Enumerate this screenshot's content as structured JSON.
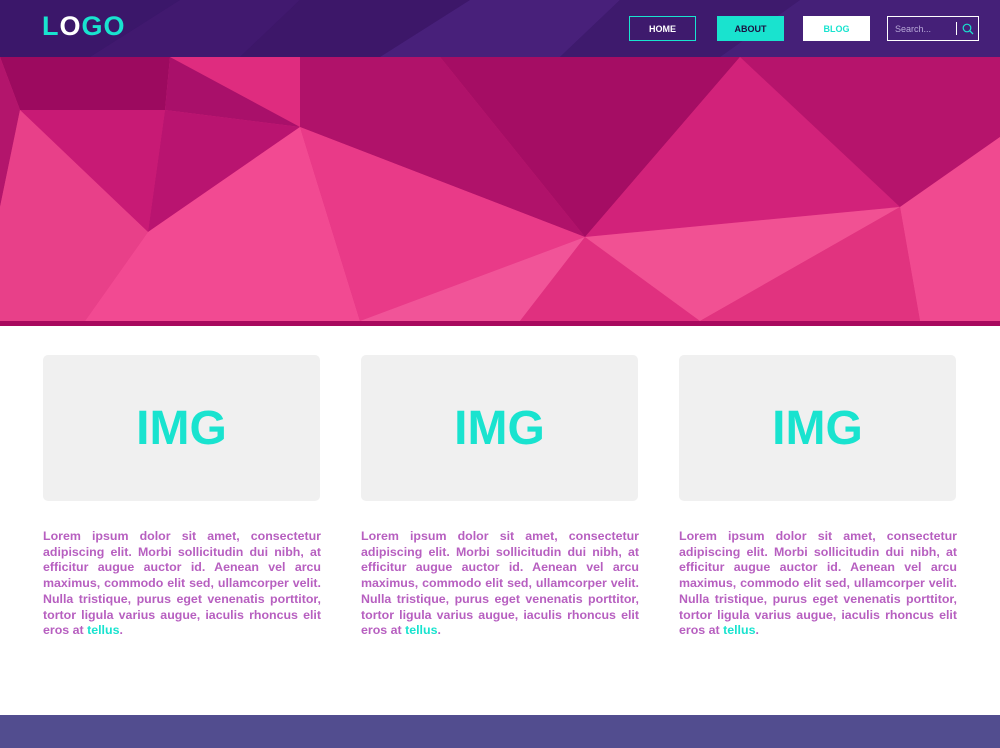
{
  "logo": {
    "part1": "L",
    "part2": "O",
    "part3": "GO"
  },
  "nav": {
    "home": "HOME",
    "about": "ABOUT",
    "blog": "BLOG"
  },
  "search": {
    "placeholder": "Search..."
  },
  "cards": [
    {
      "img_label": "IMG",
      "text": "Lorem ipsum dolor sit amet, consectetur adipiscing elit. Morbi sollicitudin dui nibh, at efficitur augue auctor id. Aenean vel arcu maximus, commodo elit sed, ullamcorper velit. Nulla tristique, purus eget venenatis porttitor, tortor ligula varius augue, iaculis rhoncus elit eros at",
      "link": "tellus",
      "end": "."
    },
    {
      "img_label": "IMG",
      "text": "Lorem ipsum dolor sit amet, consectetur adipiscing elit. Morbi sollicitudin dui nibh, at efficitur augue auctor id. Aenean vel arcu maximus, commodo elit sed, ullamcorper velit. Nulla tristique, purus eget venenatis porttitor, tortor ligula varius augue, iaculis rhoncus elit eros at",
      "link": "tellus",
      "end": "."
    },
    {
      "img_label": "IMG",
      "text": "Lorem ipsum dolor sit amet, consectetur adipiscing elit. Morbi sollicitudin dui nibh, at efficitur augue auctor id. Aenean vel arcu maximus, commodo elit sed, ullamcorper velit. Nulla tristique, purus eget venenatis porttitor, tortor ligula varius augue, iaculis rhoncus elit eros at",
      "link": "tellus",
      "end": "."
    }
  ],
  "colors": {
    "header_bg": "#3a1668",
    "accent": "#19e3cf",
    "hero_pink": "#e3307f",
    "hero_line": "#a8095e",
    "card_text": "#b75fc0",
    "card_img_bg": "#f0f0f0",
    "footer_bg": "#524d8f"
  },
  "icons": {
    "search": "search-icon"
  }
}
